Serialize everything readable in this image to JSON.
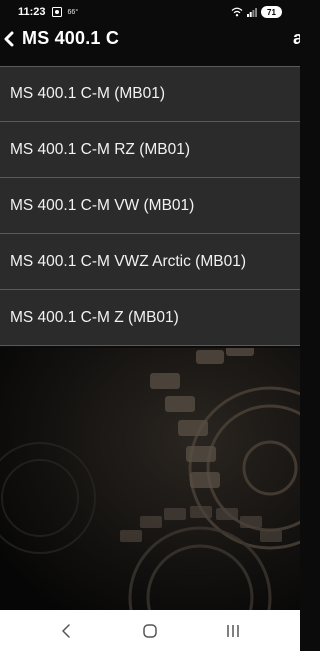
{
  "status_bar": {
    "time": "11:23",
    "temperature": "66°",
    "battery": "71"
  },
  "header": {
    "title": "MS 400.1 C"
  },
  "variants": [
    {
      "label": "MS 400.1 C-M (MB01)"
    },
    {
      "label": "MS 400.1 C-M RZ (MB01)"
    },
    {
      "label": "MS 400.1 C-M VW (MB01)"
    },
    {
      "label": "MS 400.1 C-M VWZ Arctic (MB01)"
    },
    {
      "label": "MS 400.1 C-M Z (MB01)"
    }
  ],
  "icons": {
    "back": "chevron-left-icon",
    "nav_back": "nav-back-icon",
    "nav_home": "nav-home-icon",
    "nav_recents": "nav-recents-icon"
  },
  "colors": {
    "background": "#0b0b0b",
    "list_item_bg": "#2b2b2b",
    "divider": "#5a5a5a",
    "text": "#f2f2f2",
    "nav_bar": "#ffffff"
  }
}
